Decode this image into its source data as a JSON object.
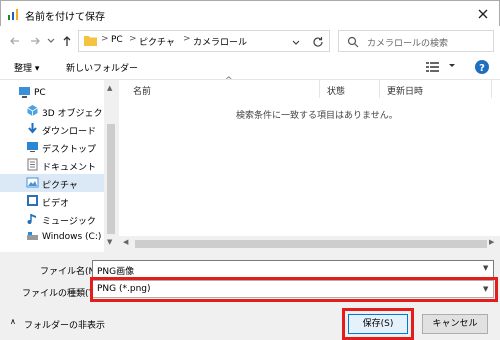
{
  "window": {
    "title": "名前を付けて保存"
  },
  "address": {
    "crumbs": [
      "PC",
      "ピクチャ",
      "カメラロール"
    ],
    "separators": [
      ">",
      ">",
      ">"
    ]
  },
  "search": {
    "placeholder": "カメラロールの検索"
  },
  "toolbar": {
    "organize_label": "整理 ▾",
    "new_folder_label": "新しいフォルダー"
  },
  "sidebar": {
    "items": [
      {
        "label": "PC",
        "icon": "pc-icon"
      },
      {
        "label": "3D オブジェクト",
        "icon": "3d-objects-icon"
      },
      {
        "label": "ダウンロード",
        "icon": "download-icon"
      },
      {
        "label": "デスクトップ",
        "icon": "desktop-icon"
      },
      {
        "label": "ドキュメント",
        "icon": "documents-icon"
      },
      {
        "label": "ピクチャ",
        "icon": "pictures-icon",
        "selected": true
      },
      {
        "label": "ビデオ",
        "icon": "video-icon"
      },
      {
        "label": "ミュージック",
        "icon": "music-icon"
      },
      {
        "label": "Windows (C:)",
        "icon": "drive-icon"
      }
    ]
  },
  "filelist": {
    "columns": [
      "名前",
      "状態",
      "更新日時"
    ],
    "empty_message": "検索条件に一致する項目はありません。"
  },
  "form": {
    "filename_label": "ファイル名(N):",
    "filename_value": "PNG画像",
    "filetype_label": "ファイルの種類(T):",
    "filetype_value": "PNG (*.png)"
  },
  "footer": {
    "hide_folders_label": "フォルダーの非表示",
    "save_label": "保存(S)",
    "cancel_label": "キャンセル"
  },
  "colors": {
    "highlight": "#e31c1c",
    "accent": "#0078d7",
    "selected_bg": "#dbe9f7"
  }
}
